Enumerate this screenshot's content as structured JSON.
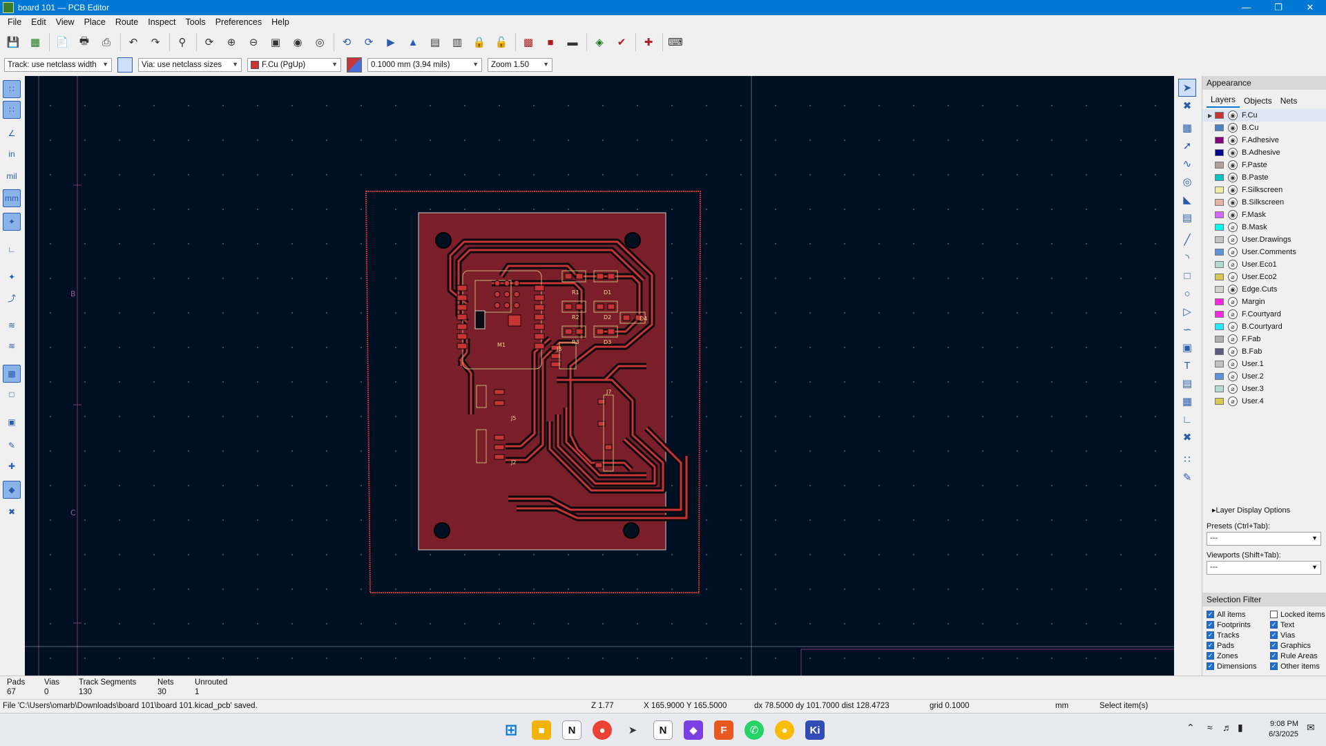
{
  "window": {
    "title": "board 101 — PCB Editor"
  },
  "menu": [
    "File",
    "Edit",
    "View",
    "Place",
    "Route",
    "Inspect",
    "Tools",
    "Preferences",
    "Help"
  ],
  "toolbar2": {
    "track": "Track: use netclass width",
    "via": "Via: use netclass sizes",
    "layer": "F.Cu (PgUp)",
    "grid": "0.1000 mm (3.94 mils)",
    "zoom": "Zoom 1.50"
  },
  "left_toolbar": {
    "units_in": "in",
    "units_mil": "mil",
    "units_mm": "mm"
  },
  "sheet_border": {
    "row_b": "B",
    "row_c": "C"
  },
  "components": [
    "R1",
    "D1",
    "R2",
    "D2",
    "R3",
    "D3",
    "M1",
    "J5",
    "J7",
    "J2",
    "J3",
    "D4"
  ],
  "appearance": {
    "title": "Appearance",
    "tabs": [
      "Layers",
      "Objects",
      "Nets"
    ],
    "layers": [
      {
        "name": "F.Cu",
        "color": "#c83434",
        "visible": true
      },
      {
        "name": "B.Cu",
        "color": "#4d7fc4",
        "visible": true
      },
      {
        "name": "F.Adhesive",
        "color": "#84007c",
        "visible": true
      },
      {
        "name": "B.Adhesive",
        "color": "#00008a",
        "visible": true
      },
      {
        "name": "F.Paste",
        "color": "#b4a09a",
        "visible": true
      },
      {
        "name": "B.Paste",
        "color": "#00c2c2",
        "visible": true
      },
      {
        "name": "F.Silkscreen",
        "color": "#f2eda1",
        "visible": true
      },
      {
        "name": "B.Silkscreen",
        "color": "#e8b2a7",
        "visible": true
      },
      {
        "name": "F.Mask",
        "color": "#d864ff",
        "visible": true
      },
      {
        "name": "B.Mask",
        "color": "#02ffee",
        "visible": false
      },
      {
        "name": "User.Drawings",
        "color": "#c2c2c2",
        "visible": false
      },
      {
        "name": "User.Comments",
        "color": "#5994dc",
        "visible": false
      },
      {
        "name": "User.Eco1",
        "color": "#b4dbd2",
        "visible": false
      },
      {
        "name": "User.Eco2",
        "color": "#d8c852",
        "visible": false
      },
      {
        "name": "Edge.Cuts",
        "color": "#d0d2cd",
        "visible": true
      },
      {
        "name": "Margin",
        "color": "#ff26e2",
        "visible": false
      },
      {
        "name": "F.Courtyard",
        "color": "#ff26e2",
        "visible": false
      },
      {
        "name": "B.Courtyard",
        "color": "#26e9ff",
        "visible": false
      },
      {
        "name": "F.Fab",
        "color": "#afafaf",
        "visible": false
      },
      {
        "name": "B.Fab",
        "color": "#585d84",
        "visible": false
      },
      {
        "name": "User.1",
        "color": "#c2c2c2",
        "visible": false
      },
      {
        "name": "User.2",
        "color": "#5994dc",
        "visible": false
      },
      {
        "name": "User.3",
        "color": "#b4dbd2",
        "visible": false
      },
      {
        "name": "User.4",
        "color": "#d8c852",
        "visible": false
      }
    ],
    "layer_display_options": "Layer Display Options",
    "presets_label": "Presets (Ctrl+Tab):",
    "presets_value": "---",
    "viewports_label": "Viewports (Shift+Tab):",
    "viewports_value": "---"
  },
  "selection_filter": {
    "title": "Selection Filter",
    "items": [
      {
        "label": "All items",
        "checked": true
      },
      {
        "label": "Locked items",
        "checked": false
      },
      {
        "label": "Footprints",
        "checked": true
      },
      {
        "label": "Text",
        "checked": true
      },
      {
        "label": "Tracks",
        "checked": true
      },
      {
        "label": "Vias",
        "checked": true
      },
      {
        "label": "Pads",
        "checked": true
      },
      {
        "label": "Graphics",
        "checked": true
      },
      {
        "label": "Zones",
        "checked": true
      },
      {
        "label": "Rule Areas",
        "checked": true
      },
      {
        "label": "Dimensions",
        "checked": true
      },
      {
        "label": "Other items",
        "checked": true
      }
    ]
  },
  "stats": {
    "pads_label": "Pads",
    "pads": "67",
    "vias_label": "Vias",
    "vias": "0",
    "tracks_label": "Track Segments",
    "tracks": "130",
    "nets_label": "Nets",
    "nets": "30",
    "unrouted_label": "Unrouted",
    "unrouted": "1"
  },
  "status": {
    "message": "File 'C:\\Users\\omarb\\Downloads\\board 101\\board 101.kicad_pcb' saved.",
    "zoom": "Z 1.77",
    "cursor": "X 165.9000  Y 165.5000",
    "delta": "dx 78.5000  dy 101.7000  dist 128.4723",
    "grid": "grid 0.1000",
    "units": "mm",
    "mode": "Select item(s)"
  },
  "clock": {
    "time": "9:08 PM",
    "date": "6/3/2025"
  }
}
